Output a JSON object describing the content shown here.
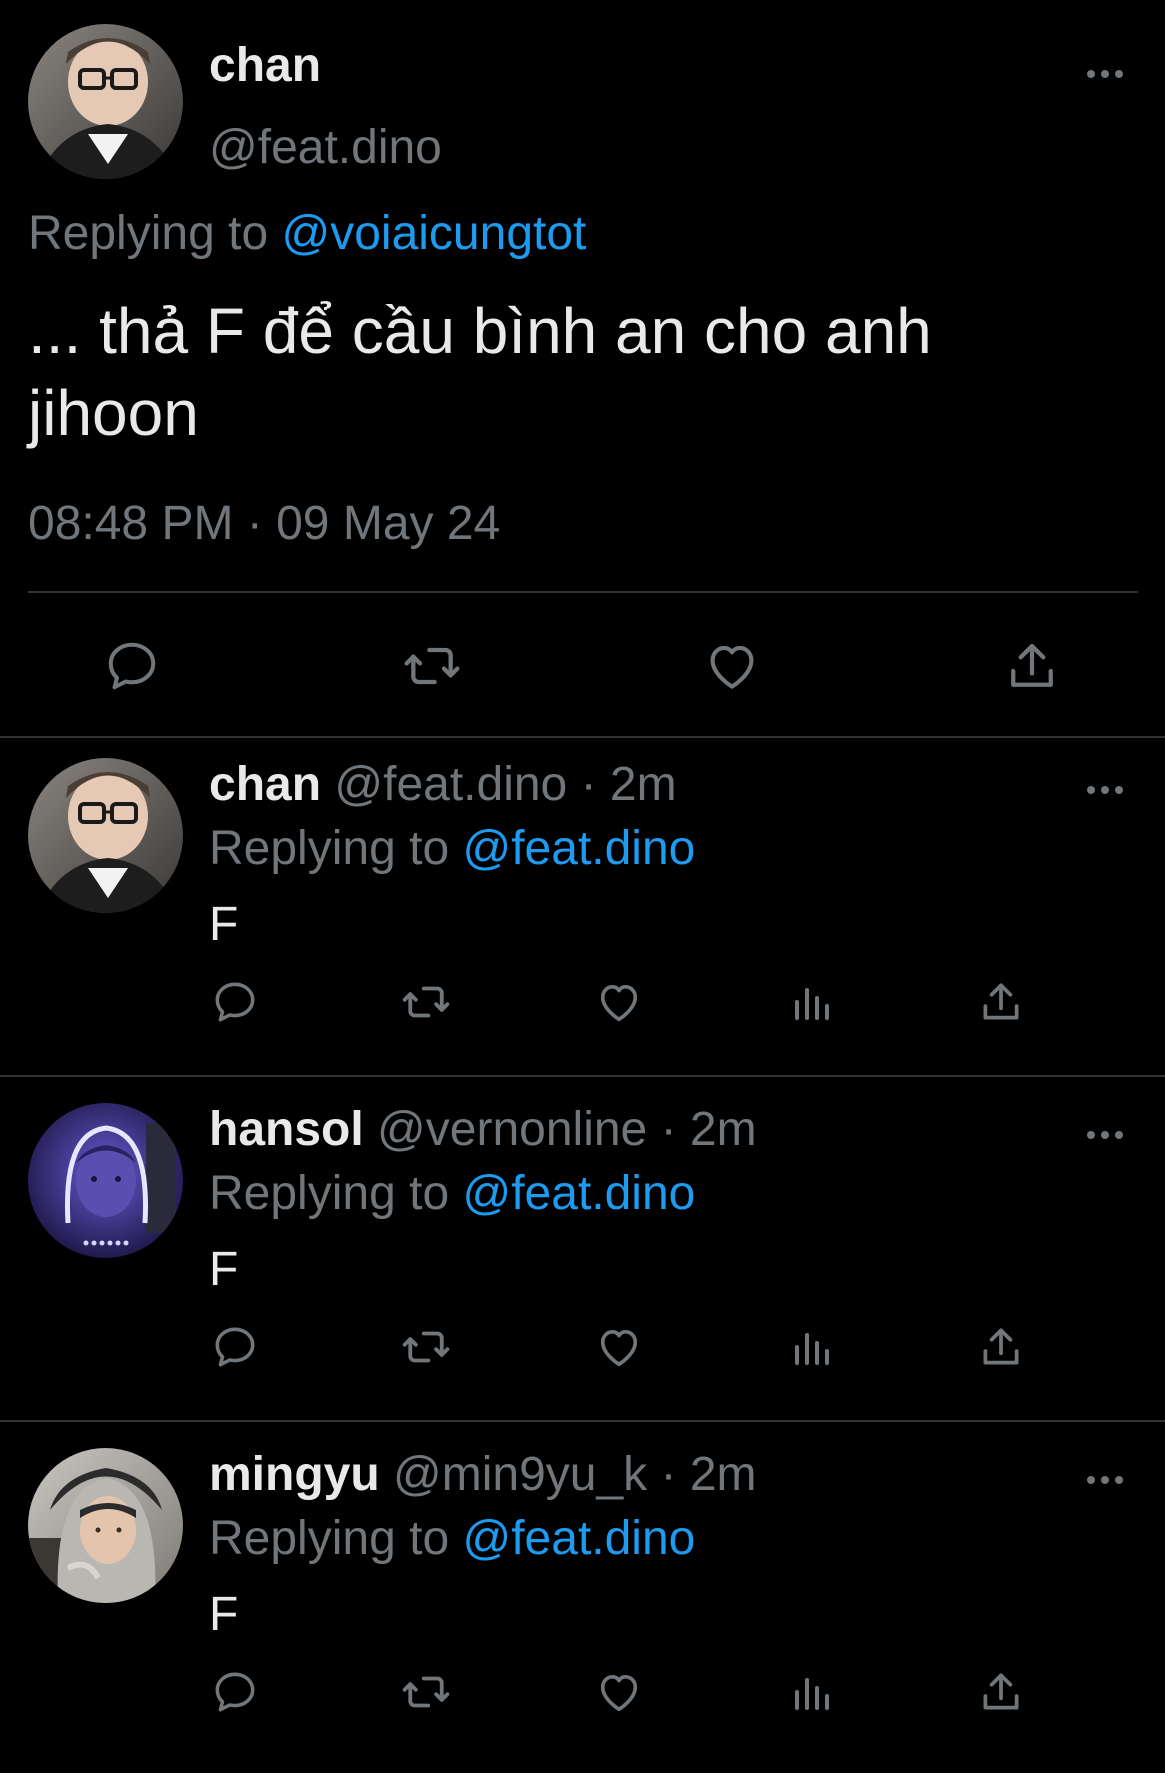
{
  "main_tweet": {
    "display_name": "chan",
    "handle": "@feat.dino",
    "replying_prefix": "Replying to",
    "replying_to": "@voiaicungtot",
    "text": "... thả F để cầu bình an cho anh jihoon",
    "timestamp": "08:48 PM · 09 May 24",
    "actions": [
      "reply-icon",
      "retweet-icon",
      "like-icon",
      "share-icon"
    ]
  },
  "replies": [
    {
      "display_name": "chan",
      "handle": "@feat.dino",
      "meta": "· 2m",
      "replying_prefix": "Replying to",
      "replying_to": "@feat.dino",
      "text": "F",
      "avatar": "selfie-glasses"
    },
    {
      "display_name": "hansol",
      "handle": "@vernonline",
      "meta": "· 2m",
      "replying_prefix": "Replying to",
      "replying_to": "@feat.dino",
      "text": "F",
      "avatar": "purple-neon"
    },
    {
      "display_name": "mingyu",
      "handle": "@min9yu_k",
      "meta": "· 2m",
      "replying_prefix": "Replying to",
      "replying_to": "@feat.dino",
      "text": "F",
      "avatar": "grey-hoodie"
    }
  ],
  "colors": {
    "background": "#000000",
    "text_primary": "#e7e9ea",
    "text_secondary": "#71767b",
    "accent": "#1d9bf0",
    "divider": "#2f3336"
  }
}
